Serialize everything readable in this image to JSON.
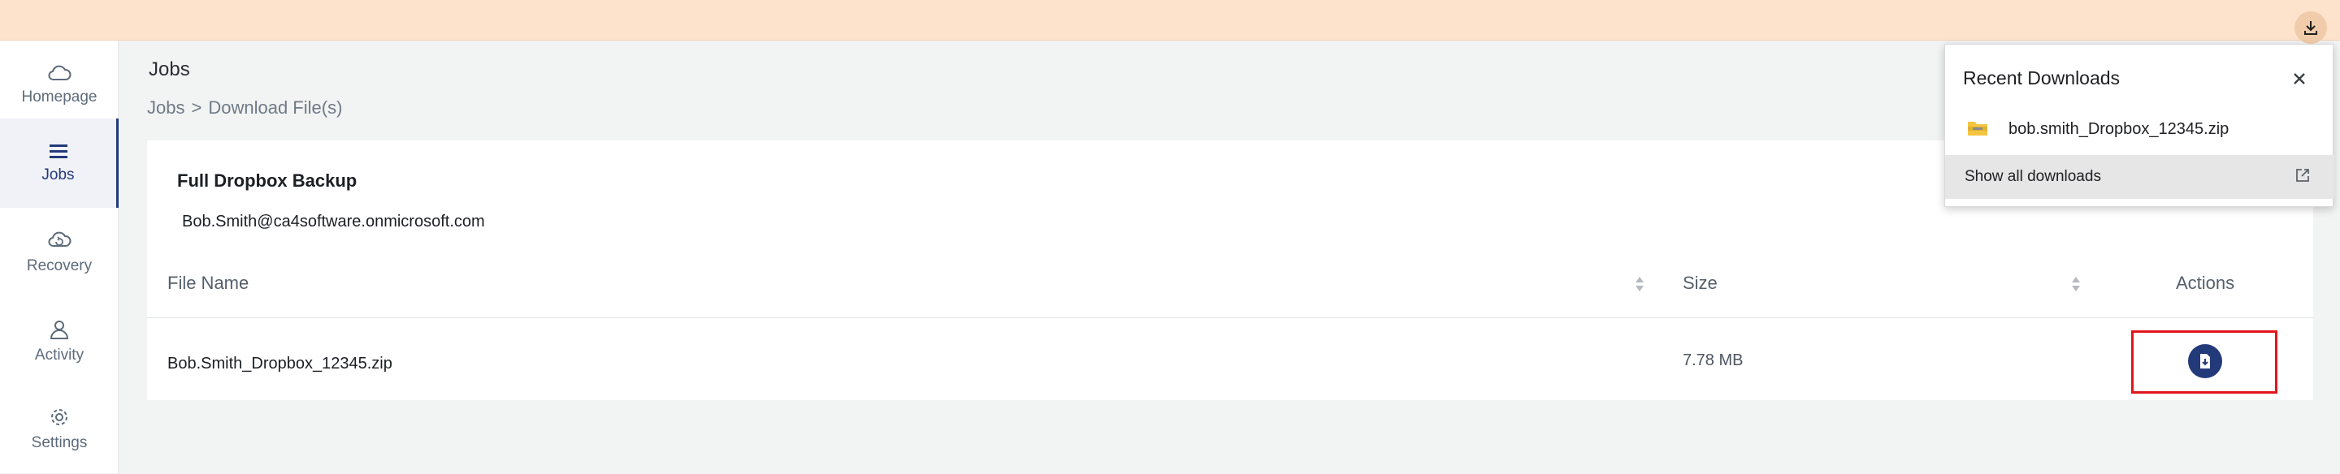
{
  "browser": {
    "downloads_icon": "download-icon",
    "popup": {
      "title": "Recent Downloads",
      "close_icon": "close-icon",
      "items": [
        {
          "file_name": "bob.smith_Dropbox_12345.zip",
          "icon": "zip-file-icon"
        }
      ],
      "show_all_label": "Show all downloads",
      "external_icon": "open-external-icon"
    }
  },
  "sidebar": {
    "items": [
      {
        "label": "Homepage",
        "icon": "cloud-icon",
        "active": false
      },
      {
        "label": "Jobs",
        "icon": "list-icon",
        "active": true
      },
      {
        "label": "Recovery",
        "icon": "cloud-restore-icon",
        "active": false
      },
      {
        "label": "Activity",
        "icon": "user-icon",
        "active": false
      },
      {
        "label": "Settings",
        "icon": "gear-icon",
        "active": false
      }
    ]
  },
  "main": {
    "title": "Jobs",
    "breadcrumb": [
      "Jobs",
      ">",
      "Download File(s)"
    ],
    "job": {
      "name": "Full Dropbox Backup",
      "account": "Bob.Smith@ca4software.onmicrosoft.com"
    },
    "table": {
      "columns": [
        "File Name",
        "Size",
        "Actions"
      ],
      "rows": [
        {
          "file_name": "Bob.Smith_Dropbox_12345.zip",
          "size": "7.78 MB",
          "action_icon": "download-file-icon"
        }
      ]
    }
  },
  "colors": {
    "accent": "#233a7a",
    "highlight": "#e0151c",
    "banner": "#fde3cc"
  }
}
